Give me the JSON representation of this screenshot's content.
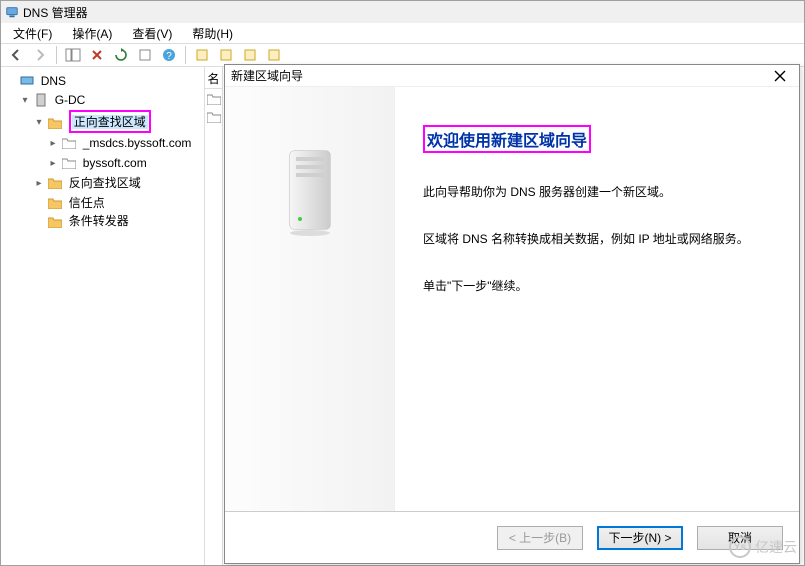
{
  "window": {
    "title": "DNS 管理器"
  },
  "menu": {
    "file": "文件(F)",
    "action": "操作(A)",
    "view": "查看(V)",
    "help": "帮助(H)"
  },
  "tree": {
    "root": "DNS",
    "server": "G-DC",
    "forward_zone": "正向查找区域",
    "zone_msdcs": "_msdcs.byssoft.com",
    "zone_main": "byssoft.com",
    "reverse_zone": "反向查找区域",
    "trust_points": "信任点",
    "conditional_fwd": "条件转发器"
  },
  "listheader": {
    "name": "名"
  },
  "wizard": {
    "title": "新建区域向导",
    "heading": "欢迎使用新建区域向导",
    "line1": "此向导帮助你为 DNS 服务器创建一个新区域。",
    "line2": "区域将 DNS 名称转换成相关数据，例如 IP 地址或网络服务。",
    "line3": "单击\"下一步\"继续。",
    "back": "< 上一步(B)",
    "next": "下一步(N) >",
    "cancel": "取消"
  },
  "watermark": {
    "text": "亿速云"
  }
}
